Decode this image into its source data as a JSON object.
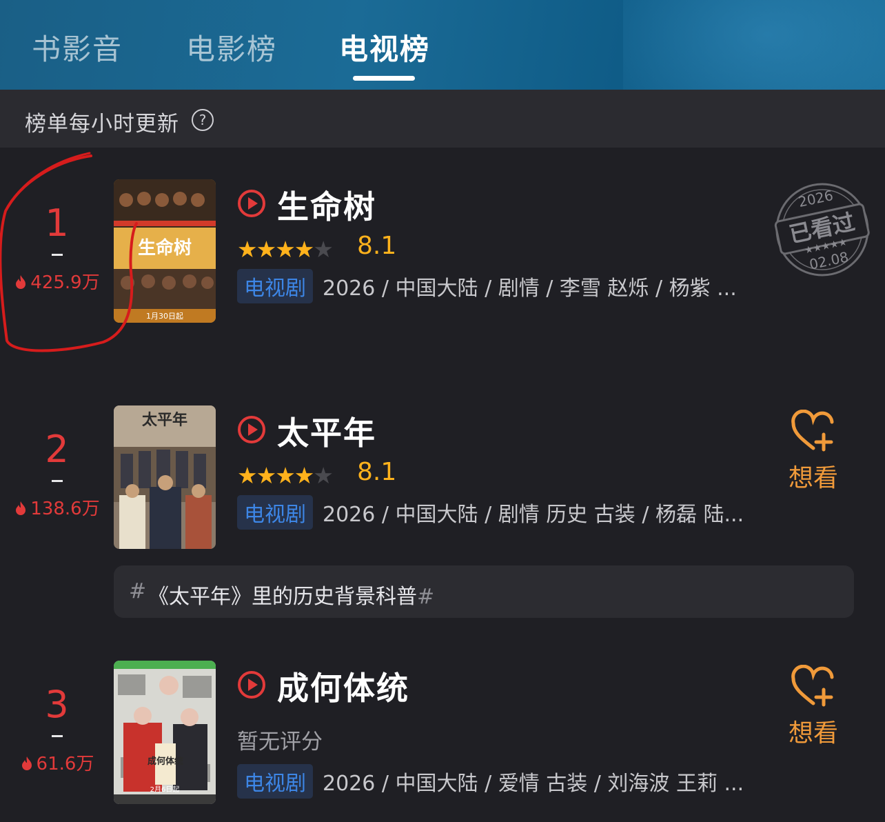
{
  "tabs": [
    {
      "label": "书影音"
    },
    {
      "label": "电影榜"
    },
    {
      "label": "电视榜"
    }
  ],
  "active_tab": "电视榜",
  "subheader": {
    "text": "榜单每小时更新",
    "help_icon": "question-circle-icon"
  },
  "items": [
    {
      "rank": "1",
      "heat": "425.9万",
      "title": "生命树",
      "score": "8.1",
      "stars_filled": 4,
      "tag": "电视剧",
      "meta": "2026 / 中国大陆 / 剧情 / 李雪 赵烁 / 杨紫 ...",
      "poster_text": "生命树",
      "poster_date": "1月30日起",
      "stamp": {
        "year": "2026",
        "label": "已看过",
        "date": "02.08"
      }
    },
    {
      "rank": "2",
      "heat": "138.6万",
      "title": "太平年",
      "score": "8.1",
      "stars_filled": 4,
      "tag": "电视剧",
      "meta": "2026 / 中国大陆 / 剧情 历史 古装 / 杨磊 陆...",
      "poster_text": "太平年",
      "want_label": "想看",
      "topic": "《太平年》里的历史背景科普"
    },
    {
      "rank": "3",
      "heat": "61.6万",
      "title": "成何体统",
      "no_rating": "暂无评分",
      "tag": "电视剧",
      "meta": "2026 / 中国大陆 / 爱情 古装 / 刘海波 王莉 ...",
      "poster_text": "成何体统",
      "poster_date": "2月6日起",
      "want_label": "想看"
    }
  ],
  "colors": {
    "accent_red": "#e23a3a",
    "star": "#ffb21c",
    "tag_blue": "#3d86e6",
    "want_orange": "#f09a3a",
    "header_blue": "#1b6b96"
  }
}
